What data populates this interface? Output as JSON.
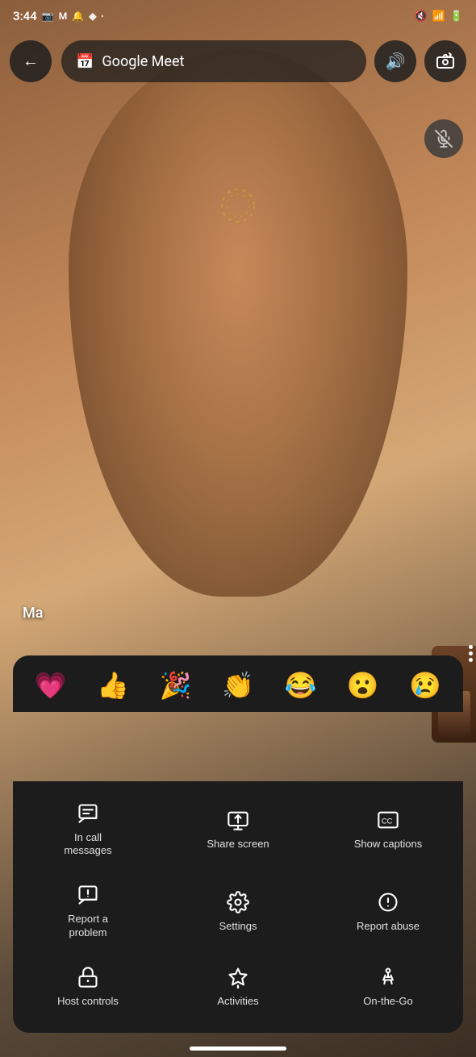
{
  "statusBar": {
    "time": "3:44",
    "icons": [
      "video-icon",
      "mail-icon",
      "notification-icon",
      "diamond-icon",
      "dot-icon"
    ],
    "rightIcons": [
      "mute-icon",
      "wifi-icon",
      "battery-icon"
    ]
  },
  "appBar": {
    "backLabel": "←",
    "calendarIcon": "📅",
    "title": "Google Meet",
    "speakerIcon": "🔊",
    "flipCameraIcon": "🔄"
  },
  "emojis": [
    {
      "symbol": "💗",
      "name": "heart"
    },
    {
      "symbol": "👍",
      "name": "thumbsup"
    },
    {
      "symbol": "🎉",
      "name": "party"
    },
    {
      "symbol": "👏",
      "name": "clap"
    },
    {
      "symbol": "😂",
      "name": "laugh"
    },
    {
      "symbol": "😮",
      "name": "wow"
    },
    {
      "symbol": "😢",
      "name": "sad"
    }
  ],
  "menuItems": [
    {
      "id": "in-call-messages",
      "label": "In call\nmessages",
      "icon": "messages"
    },
    {
      "id": "share-screen",
      "label": "Share screen",
      "icon": "sharescreen"
    },
    {
      "id": "show-captions",
      "label": "Show captions",
      "icon": "captions"
    },
    {
      "id": "report-problem",
      "label": "Report a\nproblem",
      "icon": "reportproblem"
    },
    {
      "id": "settings",
      "label": "Settings",
      "icon": "settings"
    },
    {
      "id": "report-abuse",
      "label": "Report abuse",
      "icon": "reportabuse"
    },
    {
      "id": "host-controls",
      "label": "Host controls",
      "icon": "hostcontrols"
    },
    {
      "id": "activities",
      "label": "Activities",
      "icon": "activities"
    },
    {
      "id": "on-the-go",
      "label": "On-the-Go",
      "icon": "onthego"
    }
  ],
  "nameTag": "Ma",
  "homeIndicator": true
}
